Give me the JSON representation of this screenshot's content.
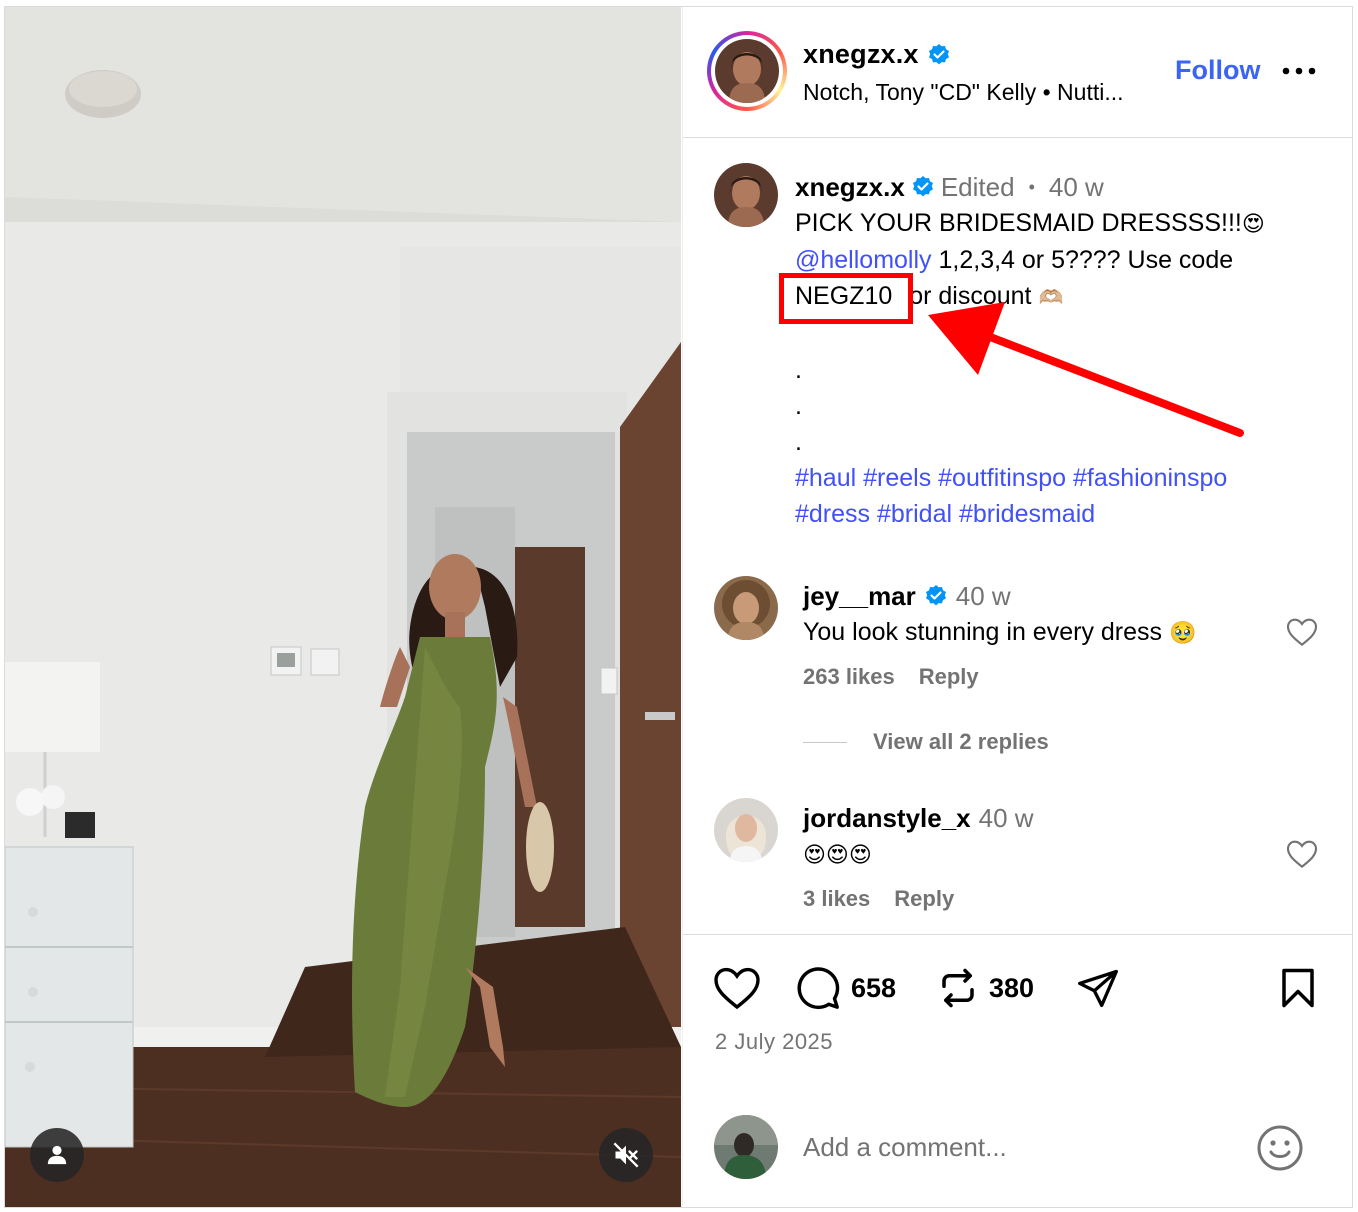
{
  "post": {
    "username": "xnegzx.x",
    "audio": "Notch, Tony \"CD\" Kelly • Nutti...",
    "follow_label": "Follow",
    "more_icon": "more-horizontal-icon"
  },
  "caption": {
    "username": "xnegzx.x",
    "edited": "Edited",
    "dot": "•",
    "time": "40 w",
    "line1": "PICK YOUR BRIDESMAID DRESSSS!!!",
    "line1_emoji": "😍",
    "mention": "@hellomolly",
    "line2_rest": " 1,2,3,4 or 5???? Use code",
    "code": "NEGZ10",
    "line3_rest": " or discount ",
    "line3_emoji": "🫶🏼",
    "dots": [
      ".",
      ".",
      "."
    ],
    "hashtags_line1": "#haul #reels #outfitinspo #fashioninspo",
    "hashtags_line2": "#dress #bridal #bridesmaid"
  },
  "comments": [
    {
      "username": "jey__mar",
      "verified": true,
      "time": "40 w",
      "text": "You look stunning in every dress ",
      "emoji": "🥹",
      "likes": "263 likes",
      "reply_label": "Reply",
      "view_replies": "View all 2 replies"
    },
    {
      "username": "jordanstyle_x",
      "verified": false,
      "time": "40 w",
      "text": "😍😍😍",
      "likes": "3 likes",
      "reply_label": "Reply"
    }
  ],
  "actions": {
    "comment_count": "658",
    "repost_count": "380",
    "date": "2 July 2025"
  },
  "add_comment": {
    "placeholder": "Add a comment..."
  },
  "colors": {
    "accent_blue": "#3b64f5",
    "link_blue": "#4150f7",
    "secondary_text": "#737373",
    "annotation_red": "#ff0000"
  }
}
